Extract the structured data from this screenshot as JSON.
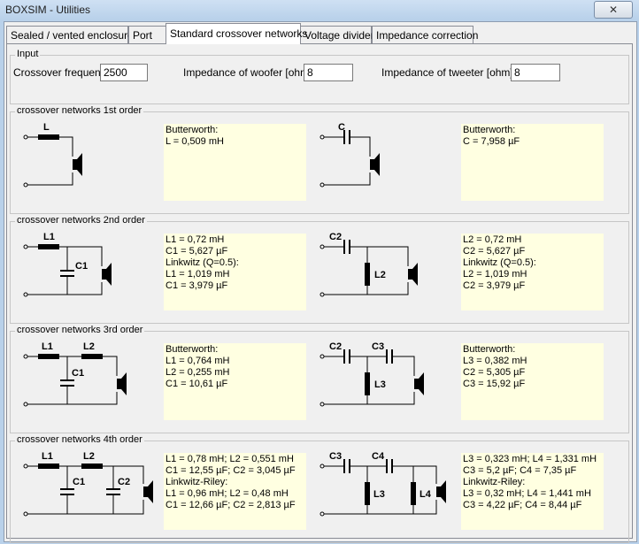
{
  "window": {
    "title": "BOXSIM - Utilities",
    "close_label": "✕"
  },
  "tabs": [
    "Sealed / vented enclosure",
    "Port",
    "Standard crossover networks",
    "Voltage divider",
    "Impedance correction"
  ],
  "input": {
    "group_title": "Input",
    "crossover_frequency_label": "Crossover frequency",
    "crossover_frequency_value": "2500",
    "woofer_label": "Impedance of woofer [ohm]",
    "woofer_value": "8",
    "tweeter_label": "Impedance of tweeter [ohm]",
    "tweeter_value": "8"
  },
  "order1": {
    "title": "crossover networks 1st order",
    "low_labels": [
      "L"
    ],
    "high_labels": [
      "C"
    ],
    "low_results": [
      "Butterworth:",
      "L = 0,509 mH"
    ],
    "high_results": [
      "Butterworth:",
      "C = 7,958 µF"
    ]
  },
  "order2": {
    "title": "crossover networks 2nd order",
    "low_labels": [
      "L1",
      "C1"
    ],
    "high_labels": [
      "C2",
      "L2"
    ],
    "low_results": [
      "L1 = 0,72 mH",
      "C1 = 5,627 µF",
      "Linkwitz (Q=0.5):",
      "L1 = 1,019 mH",
      "C1 = 3,979 µF"
    ],
    "high_results": [
      "L2 = 0,72 mH",
      "C2 = 5,627 µF",
      "Linkwitz (Q=0.5):",
      "L2 = 1,019 mH",
      "C2 = 3,979 µF"
    ]
  },
  "order3": {
    "title": "crossover networks 3rd order",
    "low_labels": [
      "L1",
      "L2",
      "C1"
    ],
    "high_labels": [
      "C2",
      "C3",
      "L3"
    ],
    "low_results": [
      "Butterworth:",
      "L1 = 0,764 mH",
      "L2 = 0,255 mH",
      "C1 = 10,61 µF"
    ],
    "high_results": [
      "Butterworth:",
      "L3 = 0,382 mH",
      "C2 = 5,305 µF",
      "C3 = 15,92 µF"
    ]
  },
  "order4": {
    "title": "crossover networks 4th order",
    "low_labels": [
      "L1",
      "L2",
      "C1",
      "C2"
    ],
    "high_labels": [
      "C3",
      "C4",
      "L3",
      "L4"
    ],
    "low_results": [
      "L1 = 0,78 mH; L2 = 0,551 mH",
      "C1 = 12,55 µF; C2 = 3,045 µF",
      "Linkwitz-Riley:",
      "L1 = 0,96 mH; L2 = 0,48 mH",
      "C1 = 12,66 µF; C2 = 2,813 µF"
    ],
    "high_results": [
      "L3 = 0,323 mH; L4 = 1,331 mH",
      "C3 = 5,2 µF; C4 = 7,35 µF",
      "Linkwitz-Riley:",
      "L3 = 0,32 mH; L4 = 1,441 mH",
      "C3 = 4,22 µF; C4 = 8,44 µF"
    ]
  },
  "icons": {
    "close": "close-icon",
    "speaker": "speaker-icon",
    "terminal": "terminal-icon"
  }
}
